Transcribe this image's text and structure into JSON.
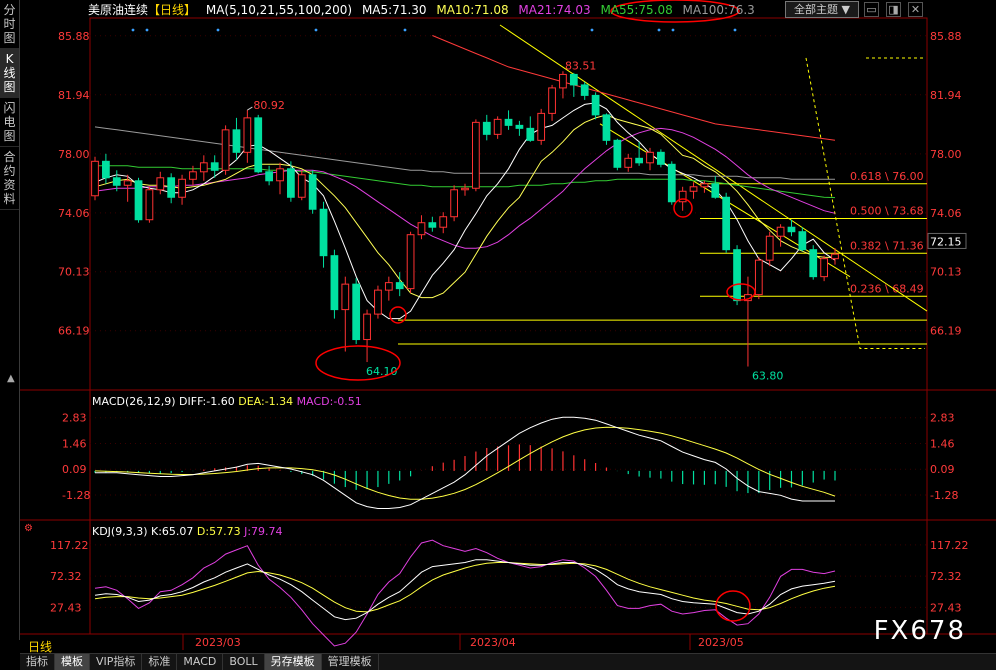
{
  "sidebar": {
    "items": [
      {
        "label": "分时图",
        "active": false
      },
      {
        "label": "K线图",
        "active": true
      },
      {
        "label": "闪电图",
        "active": false
      },
      {
        "label": "合约资料",
        "active": false
      }
    ]
  },
  "header": {
    "symbol": "美原油连续",
    "period": "【日线】",
    "ma_params": "MA(5,10,21,55,100,200)",
    "ma5": "MA5:71.30",
    "ma10": "MA10:71.08",
    "ma21": "MA21:74.03",
    "ma55": "MA55:75.08",
    "ma100": "MA100:76.3",
    "theme_button": "全部主题",
    "theme_arrow": "▼"
  },
  "colors": {
    "up": "#ff3232",
    "down": "#00e0a0",
    "ma5": "#ffffff",
    "ma10": "#ffff55",
    "ma21": "#e040e0",
    "ma55": "#33cc33",
    "ma100": "#9a9a9a",
    "ma200": "#ff3a3a",
    "dif": "#ffffff",
    "dea": "#ffff44",
    "kline": "#ffffff",
    "dline": "#ffff44",
    "jline": "#e040e0",
    "fib": "#ffff00",
    "fibtext": "#ff3a3a",
    "highlight": "#ff0000"
  },
  "price_axis": {
    "ticks": [
      "85.88",
      "81.94",
      "78.00",
      "74.06",
      "70.13",
      "66.19"
    ],
    "current": "72.15"
  },
  "macd": {
    "title": "MACD(26,12,9)",
    "diff": "DIFF:-1.60",
    "dea": "DEA:-1.34",
    "macd": "MACD:-0.51",
    "ticks": [
      "2.83",
      "1.46",
      "0.09",
      "-1.28"
    ]
  },
  "kdj": {
    "title": "KDJ(9,3,3)",
    "k": "K:65.07",
    "d": "D:57.73",
    "j": "J:79.74",
    "ticks": [
      "117.22",
      "72.32",
      "27.43"
    ]
  },
  "annotations": {
    "high1": "80.92",
    "high2": "83.51",
    "low1": "64.10",
    "low2": "63.80",
    "fib": [
      "0.618 \\ 76.00",
      "0.500 \\ 73.68",
      "0.382 \\ 71.36",
      "0.236 \\ 68.49"
    ]
  },
  "dates": [
    "2023/03",
    "2023/04",
    "2023/05"
  ],
  "period_label": "日线",
  "bottom_tabs": [
    {
      "label": "指标",
      "active": false
    },
    {
      "label": "模板",
      "active": true
    },
    {
      "label": "VIP指标",
      "active": false
    },
    {
      "label": "标准",
      "active": false
    },
    {
      "label": "MACD",
      "active": false
    },
    {
      "label": "BOLL",
      "active": false
    },
    {
      "label": "另存模板",
      "active": true
    },
    {
      "label": "管理模板",
      "active": false
    }
  ],
  "watermark": "FX678",
  "chart_data": {
    "type": "candlestick",
    "title": "美原油连续【日线】",
    "ylim": [
      62.5,
      87.0
    ],
    "candles": [
      [
        75.2,
        77.8,
        74.9,
        77.5
      ],
      [
        77.5,
        78.0,
        76.0,
        76.4
      ],
      [
        76.4,
        76.9,
        75.5,
        75.9
      ],
      [
        75.9,
        76.6,
        74.8,
        76.2
      ],
      [
        76.2,
        76.4,
        73.4,
        73.6
      ],
      [
        73.6,
        75.8,
        73.4,
        75.6
      ],
      [
        75.6,
        76.8,
        75.3,
        76.4
      ],
      [
        76.4,
        76.7,
        74.7,
        75.1
      ],
      [
        75.1,
        76.6,
        74.6,
        76.3
      ],
      [
        76.3,
        77.2,
        75.9,
        76.8
      ],
      [
        76.8,
        77.9,
        76.2,
        77.4
      ],
      [
        77.4,
        77.9,
        76.4,
        76.9
      ],
      [
        76.9,
        79.9,
        76.6,
        79.6
      ],
      [
        79.6,
        80.4,
        77.6,
        78.1
      ],
      [
        78.1,
        80.92,
        77.4,
        80.4
      ],
      [
        80.4,
        80.6,
        76.7,
        76.8
      ],
      [
        76.8,
        77.2,
        75.9,
        76.2
      ],
      [
        76.2,
        77.4,
        75.3,
        77.0
      ],
      [
        77.0,
        77.5,
        74.8,
        75.1
      ],
      [
        75.1,
        76.9,
        74.9,
        76.6
      ],
      [
        76.6,
        76.9,
        74.0,
        74.3
      ],
      [
        74.3,
        74.8,
        70.4,
        71.2
      ],
      [
        71.2,
        71.6,
        67.0,
        67.6
      ],
      [
        67.6,
        69.8,
        64.8,
        69.3
      ],
      [
        69.3,
        69.7,
        65.3,
        65.6
      ],
      [
        65.6,
        67.6,
        64.1,
        67.3
      ],
      [
        67.3,
        69.2,
        67.0,
        68.9
      ],
      [
        68.9,
        69.8,
        68.2,
        69.4
      ],
      [
        69.4,
        70.1,
        68.5,
        69.0
      ],
      [
        69.0,
        72.8,
        68.7,
        72.6
      ],
      [
        72.6,
        73.9,
        72.3,
        73.4
      ],
      [
        73.4,
        73.8,
        72.8,
        73.1
      ],
      [
        73.1,
        74.1,
        72.7,
        73.8
      ],
      [
        73.8,
        75.9,
        73.5,
        75.6
      ],
      [
        75.6,
        76.0,
        75.2,
        75.7
      ],
      [
        75.7,
        80.3,
        75.5,
        80.1
      ],
      [
        80.1,
        80.6,
        78.9,
        79.3
      ],
      [
        79.3,
        80.5,
        79.0,
        80.3
      ],
      [
        80.3,
        80.9,
        79.6,
        79.9
      ],
      [
        79.9,
        80.2,
        79.2,
        79.7
      ],
      [
        79.7,
        80.5,
        78.8,
        78.9
      ],
      [
        78.9,
        81.0,
        78.6,
        80.7
      ],
      [
        80.7,
        82.6,
        80.2,
        82.4
      ],
      [
        82.4,
        83.51,
        81.7,
        83.3
      ],
      [
        83.3,
        83.4,
        81.8,
        82.6
      ],
      [
        82.6,
        82.8,
        81.6,
        81.9
      ],
      [
        81.9,
        82.1,
        80.3,
        80.6
      ],
      [
        80.6,
        80.7,
        78.6,
        78.9
      ],
      [
        78.9,
        79.0,
        76.9,
        77.1
      ],
      [
        77.1,
        78.0,
        76.8,
        77.7
      ],
      [
        77.7,
        78.8,
        77.2,
        77.4
      ],
      [
        77.4,
        78.4,
        76.9,
        78.1
      ],
      [
        78.1,
        78.3,
        77.1,
        77.3
      ],
      [
        77.3,
        77.5,
        74.6,
        74.8
      ],
      [
        74.8,
        75.8,
        74.2,
        75.5
      ],
      [
        75.5,
        76.1,
        75.0,
        75.8
      ],
      [
        75.8,
        76.2,
        75.4,
        76.0
      ],
      [
        76.0,
        76.5,
        75.0,
        75.1
      ],
      [
        75.1,
        75.4,
        71.4,
        71.6
      ],
      [
        71.6,
        71.9,
        67.9,
        68.2
      ],
      [
        68.2,
        69.8,
        63.8,
        68.6
      ],
      [
        68.6,
        71.1,
        68.3,
        70.9
      ],
      [
        70.9,
        72.8,
        70.5,
        72.5
      ],
      [
        72.5,
        73.3,
        71.8,
        73.1
      ],
      [
        73.1,
        73.6,
        72.5,
        72.8
      ],
      [
        72.8,
        73.1,
        71.5,
        71.6
      ],
      [
        71.6,
        71.9,
        69.6,
        69.8
      ],
      [
        69.8,
        71.2,
        69.5,
        71.0
      ],
      [
        71.0,
        71.7,
        70.6,
        71.3
      ]
    ],
    "ma_lines": {
      "ma5": [
        76.1,
        76.4,
        76.6,
        76.5,
        75.9,
        75.7,
        75.6,
        75.4,
        75.4,
        75.6,
        76.0,
        76.5,
        77.0,
        77.6,
        78.5,
        78.6,
        78.2,
        77.7,
        77.2,
        76.4,
        76.0,
        75.2,
        73.5,
        71.7,
        69.8,
        68.2,
        67.5,
        67.0,
        67.0,
        67.5,
        68.7,
        69.9,
        70.7,
        71.6,
        72.9,
        74.0,
        75.2,
        76.0,
        77.0,
        78.3,
        79.3,
        79.7,
        79.9,
        80.4,
        80.9,
        81.3,
        81.4,
        81.0,
        80.1,
        79.4,
        78.8,
        78.0,
        77.5,
        77.0,
        76.7,
        76.4,
        76.0,
        75.6,
        74.8,
        73.6,
        72.2,
        71.0,
        70.6,
        70.2,
        71.0,
        71.9,
        72.3,
        71.4,
        70.9
      ],
      "ma10": [
        75.8,
        76.0,
        76.2,
        76.3,
        76.0,
        75.9,
        75.9,
        75.8,
        75.7,
        75.8,
        75.9,
        76.1,
        76.3,
        76.7,
        77.1,
        77.3,
        77.3,
        77.3,
        77.2,
        77.0,
        76.6,
        75.9,
        75.2,
        74.4,
        73.4,
        72.4,
        71.4,
        70.6,
        69.6,
        68.7,
        68.4,
        68.4,
        68.7,
        69.4,
        70.1,
        71.3,
        72.5,
        73.5,
        74.4,
        75.1,
        76.3,
        77.5,
        78.1,
        78.8,
        79.6,
        80.1,
        80.4,
        80.6,
        80.3,
        80.1,
        79.9,
        79.7,
        79.3,
        78.6,
        77.9,
        77.7,
        77.2,
        76.8,
        76.2,
        75.5,
        74.6,
        73.6,
        72.9,
        72.2,
        71.8,
        71.5,
        71.2,
        71.1,
        71.08
      ],
      "ma21": [
        75.5,
        75.6,
        75.7,
        75.7,
        75.7,
        75.8,
        75.8,
        75.8,
        75.9,
        75.9,
        76.0,
        76.1,
        76.2,
        76.3,
        76.4,
        76.6,
        76.7,
        76.8,
        76.9,
        76.9,
        76.9,
        76.8,
        76.5,
        76.2,
        75.8,
        75.3,
        74.8,
        74.3,
        73.8,
        73.3,
        72.9,
        72.5,
        72.2,
        71.9,
        71.7,
        71.7,
        71.8,
        72.1,
        72.6,
        73.2,
        73.7,
        74.3,
        74.9,
        75.5,
        76.3,
        77.0,
        77.6,
        78.2,
        78.7,
        79.1,
        79.4,
        79.6,
        79.7,
        79.6,
        79.4,
        79.1,
        78.7,
        78.3,
        77.8,
        77.2,
        76.6,
        76.1,
        75.7,
        75.4,
        75.1,
        74.8,
        74.5,
        74.2,
        74.03
      ],
      "ma55": [
        77.2,
        77.2,
        77.2,
        77.2,
        77.1,
        77.1,
        77.1,
        77.1,
        77.0,
        77.0,
        77.0,
        77.0,
        77.0,
        77.0,
        77.0,
        77.0,
        76.9,
        76.9,
        76.9,
        76.8,
        76.8,
        76.7,
        76.6,
        76.5,
        76.4,
        76.3,
        76.2,
        76.1,
        76.0,
        75.9,
        75.9,
        75.8,
        75.8,
        75.8,
        75.8,
        75.8,
        75.8,
        75.8,
        75.8,
        75.9,
        75.9,
        75.9,
        76.0,
        76.0,
        76.1,
        76.1,
        76.2,
        76.2,
        76.3,
        76.3,
        76.3,
        76.3,
        76.3,
        76.3,
        76.3,
        76.2,
        76.2,
        76.1,
        76.0,
        75.9,
        75.8,
        75.7,
        75.6,
        75.5,
        75.4,
        75.3,
        75.2,
        75.1,
        75.08
      ],
      "ma100": [
        79.8,
        79.7,
        79.6,
        79.5,
        79.4,
        79.3,
        79.2,
        79.1,
        79.0,
        78.9,
        78.8,
        78.7,
        78.6,
        78.5,
        78.4,
        78.3,
        78.2,
        78.1,
        78.0,
        77.9,
        77.8,
        77.7,
        77.6,
        77.5,
        77.4,
        77.3,
        77.2,
        77.1,
        77.0,
        76.9,
        76.9,
        76.8,
        76.8,
        76.7,
        76.7,
        76.7,
        76.7,
        76.7,
        76.7,
        76.7,
        76.7,
        76.7,
        76.7,
        76.7,
        76.7,
        76.7,
        76.7,
        76.7,
        76.7,
        76.7,
        76.7,
        76.6,
        76.6,
        76.6,
        76.6,
        76.6,
        76.5,
        76.5,
        76.5,
        76.5,
        76.4,
        76.4,
        76.4,
        76.4,
        76.3,
        76.3,
        76.3,
        76.3,
        76.3
      ],
      "ma200": [
        null,
        null,
        null,
        null,
        null,
        null,
        null,
        null,
        null,
        null,
        null,
        null,
        null,
        null,
        null,
        null,
        null,
        null,
        null,
        null,
        null,
        null,
        null,
        null,
        null,
        null,
        null,
        null,
        null,
        null,
        null,
        85.9,
        85.6,
        85.3,
        85.0,
        84.7,
        84.4,
        84.1,
        83.8,
        83.6,
        83.4,
        83.2,
        83.0,
        82.8,
        82.6,
        82.4,
        82.2,
        82.0,
        81.8,
        81.6,
        81.4,
        81.2,
        81.0,
        80.8,
        80.6,
        80.4,
        80.2,
        80.0,
        79.9,
        79.8,
        79.7,
        79.6,
        79.5,
        79.4,
        79.3,
        79.2,
        79.1,
        79.0,
        78.9
      ]
    },
    "fib_levels": [
      {
        "label": "0.618 \\ 76.00",
        "value": 76.0
      },
      {
        "label": "0.500 \\ 73.68",
        "value": 73.68
      },
      {
        "label": "0.382 \\ 71.36",
        "value": 71.36
      },
      {
        "label": "0.236 \\ 68.49",
        "value": 68.49
      }
    ],
    "support_levels": [
      66.9,
      65.3
    ],
    "macd_series": {
      "ylim": [
        -2.4,
        3.4
      ],
      "diff": [
        -0.1,
        -0.1,
        -0.1,
        -0.15,
        -0.2,
        -0.25,
        -0.3,
        -0.3,
        -0.25,
        -0.2,
        -0.1,
        0.0,
        0.1,
        0.2,
        0.35,
        0.4,
        0.3,
        0.2,
        0.1,
        -0.05,
        -0.2,
        -0.5,
        -0.9,
        -1.3,
        -1.7,
        -1.9,
        -2.0,
        -2.0,
        -1.95,
        -1.8,
        -1.5,
        -1.2,
        -0.9,
        -0.6,
        -0.2,
        0.3,
        0.8,
        1.2,
        1.6,
        2.0,
        2.3,
        2.55,
        2.75,
        2.85,
        2.85,
        2.8,
        2.7,
        2.5,
        2.3,
        2.1,
        1.9,
        1.75,
        1.6,
        1.3,
        1.0,
        0.8,
        0.6,
        0.45,
        0.1,
        -0.4,
        -0.8,
        -1.1,
        -1.2,
        -1.3,
        -1.5,
        -1.6,
        -1.6,
        -1.6,
        -1.6
      ],
      "dea": [
        0.0,
        -0.02,
        -0.04,
        -0.06,
        -0.09,
        -0.12,
        -0.15,
        -0.18,
        -0.19,
        -0.19,
        -0.17,
        -0.14,
        -0.09,
        -0.03,
        0.05,
        0.12,
        0.16,
        0.17,
        0.16,
        0.12,
        0.06,
        -0.05,
        -0.22,
        -0.44,
        -0.69,
        -0.93,
        -1.14,
        -1.31,
        -1.44,
        -1.51,
        -1.51,
        -1.45,
        -1.34,
        -1.19,
        -0.99,
        -0.73,
        -0.42,
        -0.1,
        0.24,
        0.59,
        0.93,
        1.25,
        1.55,
        1.81,
        2.02,
        2.18,
        2.28,
        2.32,
        2.31,
        2.27,
        2.2,
        2.11,
        2.01,
        1.87,
        1.7,
        1.52,
        1.34,
        1.16,
        0.95,
        0.68,
        0.38,
        0.08,
        -0.18,
        -0.4,
        -0.62,
        -0.82,
        -0.98,
        -1.14,
        -1.34
      ],
      "hist": [
        -0.1,
        -0.08,
        -0.06,
        -0.09,
        -0.11,
        -0.13,
        -0.15,
        -0.12,
        -0.06,
        -0.01,
        0.07,
        0.14,
        0.19,
        0.23,
        0.3,
        0.28,
        0.14,
        0.03,
        -0.06,
        -0.17,
        -0.26,
        -0.45,
        -0.68,
        -0.86,
        -1.01,
        -0.97,
        -0.86,
        -0.69,
        -0.51,
        -0.29,
        0.01,
        0.25,
        0.44,
        0.59,
        0.79,
        1.03,
        1.22,
        1.3,
        1.36,
        1.41,
        1.37,
        1.3,
        1.2,
        1.04,
        0.83,
        0.62,
        0.42,
        0.18,
        -0.01,
        -0.17,
        -0.3,
        -0.36,
        -0.41,
        -0.57,
        -0.7,
        -0.72,
        -0.74,
        -0.71,
        -0.85,
        -1.08,
        -1.18,
        -1.18,
        -1.02,
        -0.9,
        -0.88,
        -0.78,
        -0.62,
        -0.46,
        -0.51
      ]
    },
    "kdj_series": {
      "ylim": [
        -5,
        130
      ],
      "k": [
        45,
        47,
        46,
        42,
        36,
        38,
        44,
        46,
        50,
        56,
        64,
        70,
        78,
        84,
        90,
        82,
        74,
        68,
        60,
        50,
        38,
        26,
        14,
        10,
        12,
        20,
        32,
        42,
        50,
        64,
        78,
        86,
        88,
        90,
        92,
        96,
        96,
        94,
        92,
        90,
        88,
        88,
        90,
        92,
        92,
        88,
        82,
        72,
        60,
        54,
        50,
        48,
        46,
        40,
        36,
        34,
        33,
        32,
        26,
        20,
        18,
        22,
        32,
        46,
        54,
        58,
        60,
        62,
        65.07
      ],
      "d": [
        40,
        42,
        43,
        43,
        41,
        40,
        41,
        43,
        45,
        49,
        54,
        59,
        65,
        71,
        77,
        79,
        77,
        74,
        69,
        63,
        55,
        45,
        35,
        27,
        22,
        21,
        25,
        31,
        37,
        46,
        57,
        67,
        74,
        79,
        84,
        88,
        91,
        92,
        92,
        91,
        90,
        89,
        89,
        90,
        91,
        90,
        87,
        82,
        75,
        68,
        62,
        57,
        53,
        49,
        45,
        41,
        38,
        36,
        33,
        29,
        25,
        24,
        27,
        33,
        40,
        46,
        51,
        55,
        57.73
      ],
      "j": [
        55,
        57,
        52,
        40,
        26,
        34,
        50,
        52,
        60,
        70,
        84,
        92,
        104,
        110,
        116,
        88,
        68,
        56,
        42,
        24,
        4,
        -12,
        -28,
        -24,
        -8,
        18,
        46,
        64,
        76,
        100,
        120,
        124,
        116,
        112,
        108,
        112,
        106,
        98,
        92,
        88,
        84,
        86,
        92,
        96,
        94,
        84,
        72,
        52,
        30,
        26,
        26,
        30,
        32,
        22,
        18,
        20,
        23,
        24,
        12,
        2,
        4,
        18,
        42,
        72,
        82,
        82,
        78,
        76,
        79.74
      ]
    }
  }
}
